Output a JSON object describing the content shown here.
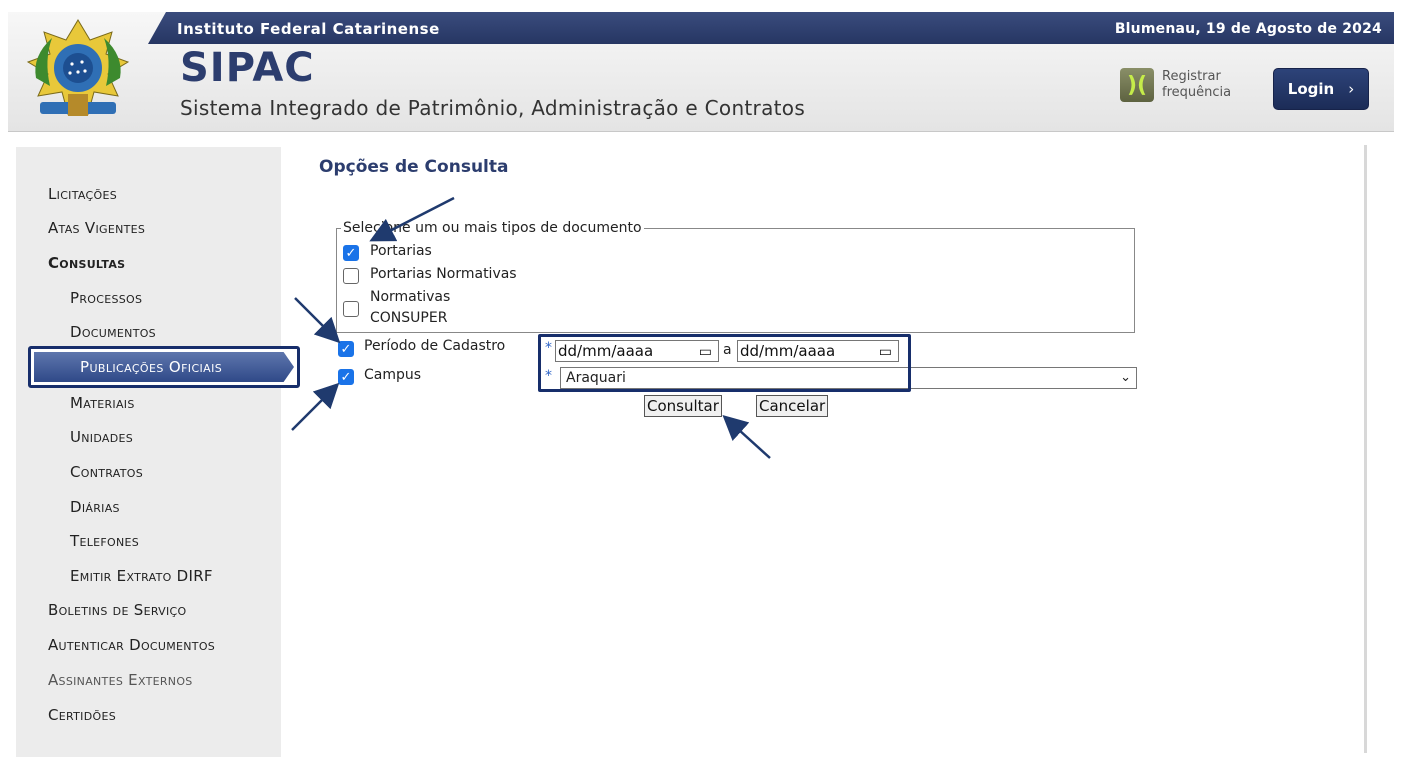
{
  "header": {
    "institution": "Instituto Federal Catarinense",
    "date": "Blumenau, 19 de Agosto de 2024",
    "app_name": "SIPAC",
    "app_subtitle": "Sistema Integrado de Patrimônio, Administração e Contratos",
    "register_line1": "Registrar",
    "register_line2": "frequência",
    "register_icon": "frequency-icon",
    "login_label": "Login",
    "login_icon": "chevron-right-icon"
  },
  "sidebar": {
    "items": [
      {
        "label": "Licitações"
      },
      {
        "label": "Atas Vigentes"
      },
      {
        "label": "Consultas"
      },
      {
        "label": "Processos"
      },
      {
        "label": "Documentos"
      },
      {
        "label": "Publicações Oficiais"
      },
      {
        "label": "Materiais"
      },
      {
        "label": "Unidades"
      },
      {
        "label": "Contratos"
      },
      {
        "label": "Diárias"
      },
      {
        "label": "Telefones"
      },
      {
        "label": "Emitir Extrato DIRF"
      },
      {
        "label": "Boletins de Serviço"
      },
      {
        "label": "Autenticar Documentos"
      },
      {
        "label": "Assinantes Externos"
      },
      {
        "label": "Certidões"
      }
    ],
    "active_item": "Publicações Oficiais"
  },
  "main": {
    "title": "Opções de Consulta",
    "doc_types_legend": "Selecione um ou mais tipos de documento",
    "doc_types": [
      {
        "label": "Portarias",
        "checked": true
      },
      {
        "label": "Portarias Normativas",
        "checked": false
      },
      {
        "label": "Normativas",
        "label2": "CONSUPER",
        "checked": false
      }
    ],
    "periodo": {
      "label": "Período de Cadastro",
      "checked": true,
      "start_placeholder": "dd/mm/aaaa",
      "end_placeholder": "dd/mm/aaaa",
      "separator": "a"
    },
    "campus": {
      "label": "Campus",
      "checked": true,
      "value": "Araquari"
    },
    "required_marker": "*",
    "check_mark": "✓",
    "buttons": {
      "submit": "Consultar",
      "cancel": "Cancelar"
    }
  },
  "colors": {
    "header_bar": "#2c3d6e",
    "active_menu": "#3e5896",
    "highlight": "#172e6b",
    "checkbox": "#1a73e8"
  }
}
